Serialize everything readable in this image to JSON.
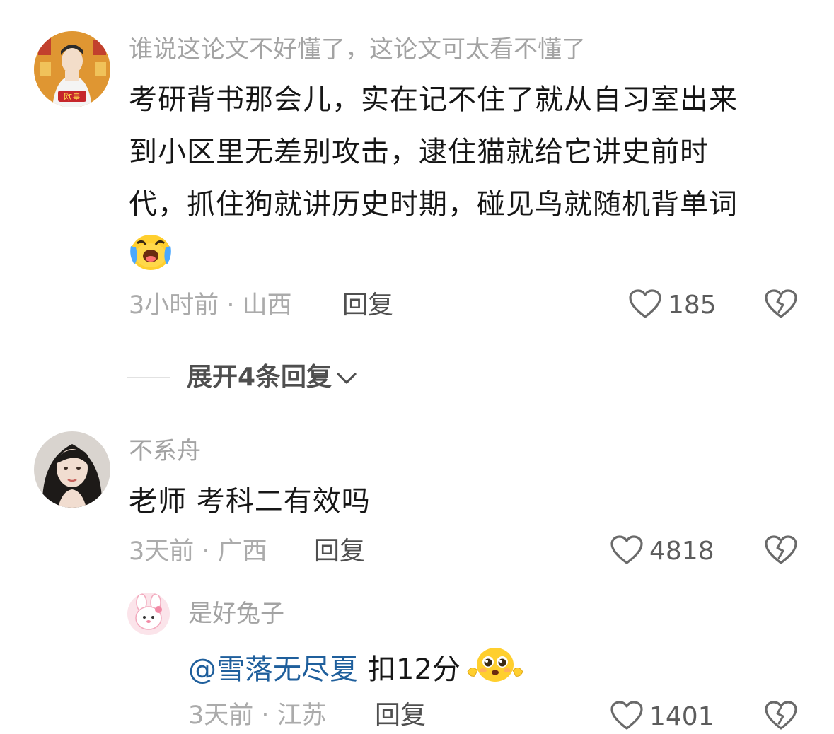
{
  "comments": [
    {
      "username": "谁说这论文不好懂了，这论文可太看不懂了",
      "content_lines": [
        "考研背书那会儿，实在记不住了就从自习室出来",
        "到小区里无差别攻击，逮住猫就给它讲史前时",
        "代，抓住狗就讲历史时期，碰见鸟就随机背单词"
      ],
      "emoji": "crying-laughing-emoji",
      "time_location": "3小时前 · 山西",
      "reply_label": "回复",
      "likes": "185",
      "avatar_badge": "欧皇",
      "expand_label": "展开4条回复"
    },
    {
      "username": "不系舟",
      "content": "老师 考科二有效吗",
      "time_location": "3天前 · 广西",
      "reply_label": "回复",
      "likes": "4818"
    }
  ],
  "sub_reply": {
    "username": "是好兔子",
    "mention": "@雪落无尽夏",
    "content": "扣12分",
    "emoji": "pleading-emoji",
    "time_location": "3天前 · 江苏",
    "reply_label": "回复",
    "likes": "1401"
  },
  "colors": {
    "username": "#a3a3a3",
    "text": "#161616",
    "mention": "#1f5f9c",
    "meta": "#ababab"
  }
}
